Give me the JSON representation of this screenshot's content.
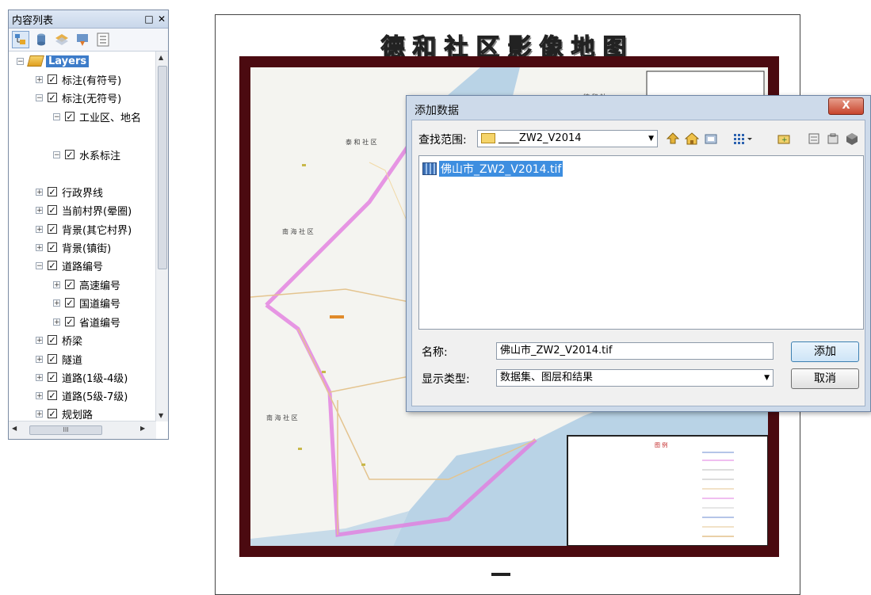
{
  "toc": {
    "title": "内容列表",
    "pin": "□",
    "close": "✕",
    "root_label": "Layers",
    "items": [
      {
        "label": "标注(有符号)",
        "expander": "⊞",
        "checked": "☑"
      },
      {
        "label": "标注(无符号)",
        "expander": "⊟",
        "checked": "☑"
      },
      {
        "label": "工业区、地名",
        "expander": "⊟",
        "checked": "☑"
      },
      {
        "label": "水系标注",
        "expander": "⊟",
        "checked": "☑"
      },
      {
        "label": "行政界线",
        "expander": "⊞",
        "checked": "☑"
      },
      {
        "label": "当前村界(晕圈)",
        "expander": "⊞",
        "checked": "☑"
      },
      {
        "label": "背景(其它村界)",
        "expander": "⊞",
        "checked": "☑"
      },
      {
        "label": "背景(镇街)",
        "expander": "⊞",
        "checked": "☑"
      },
      {
        "label": "道路编号",
        "expander": "⊟",
        "checked": "☑"
      },
      {
        "label": "高速编号",
        "expander": "⊞",
        "checked": "☑"
      },
      {
        "label": "国道编号",
        "expander": "⊞",
        "checked": "☑"
      },
      {
        "label": "省道编号",
        "expander": "⊞",
        "checked": "☑"
      },
      {
        "label": "桥梁",
        "expander": "⊞",
        "checked": "☑"
      },
      {
        "label": "隧道",
        "expander": "⊞",
        "checked": "☑"
      },
      {
        "label": "道路(1级-4级)",
        "expander": "⊞",
        "checked": "☑"
      },
      {
        "label": "道路(5级-7级)",
        "expander": "⊞",
        "checked": "☑"
      },
      {
        "label": "规划路",
        "expander": "⊞",
        "checked": "☑"
      }
    ],
    "hscroll_grip": "III"
  },
  "map": {
    "title": "德和社区影像地图",
    "legend_title": "图 例"
  },
  "dialog": {
    "title": "添加数据",
    "close": "X",
    "lookin_label": "查找范围:",
    "lookin_value": "____ZW2_V2014",
    "file_item": "佛山市_ZW2_V2014.tif",
    "name_label": "名称:",
    "name_value": "佛山市_ZW2_V2014.tif",
    "type_label": "显示类型:",
    "type_value": "数据集、图层和结果",
    "add_button": "添加",
    "cancel_button": "取消"
  },
  "colors": {
    "frame": "#4b0a10",
    "river": "#b9d3e6",
    "boundary": "#e27de0",
    "selection": "#3d8ee0"
  }
}
